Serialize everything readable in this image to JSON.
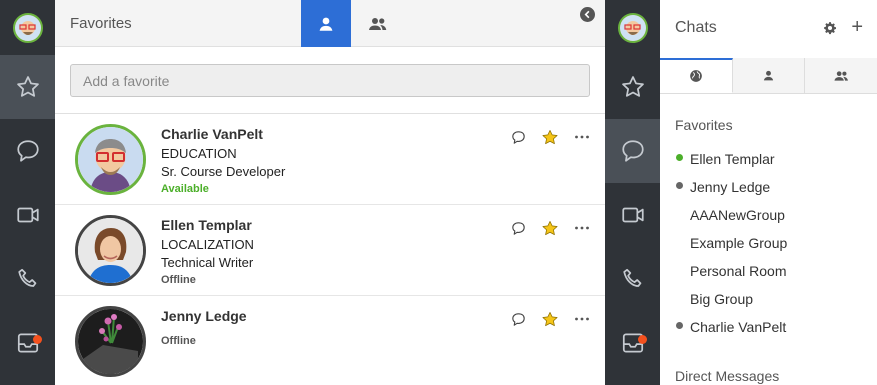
{
  "colors": {
    "rail": "#2f3338",
    "rail_active": "#4a5057",
    "accent": "#2d6ed6",
    "online": "#4caf2a",
    "offline": "#666666",
    "star": "#f5c518",
    "notify": "#f4511e"
  },
  "favorites_panel": {
    "title": "Favorites",
    "search_placeholder": "Add a favorite",
    "items": [
      {
        "name": "Charlie VanPelt",
        "line2": "EDUCATION",
        "line3": "Sr. Course Developer",
        "status": "Available"
      },
      {
        "name": "Ellen Templar",
        "line2": "LOCALIZATION",
        "line3": "Technical Writer",
        "status": "Offline"
      },
      {
        "name": "Jenny Ledge",
        "line2": "",
        "line3": "",
        "status": "Offline"
      }
    ]
  },
  "chats_panel": {
    "title": "Chats",
    "favorites_header": "Favorites",
    "favorites": [
      {
        "name": "Ellen Templar",
        "presence": "online"
      },
      {
        "name": "Jenny Ledge",
        "presence": "offline"
      },
      {
        "name": "AAANewGroup",
        "presence": ""
      },
      {
        "name": "Example Group",
        "presence": ""
      },
      {
        "name": "Personal Room",
        "presence": ""
      },
      {
        "name": "Big Group",
        "presence": ""
      },
      {
        "name": "Charlie VanPelt",
        "presence": "offline"
      }
    ],
    "direct_header": "Direct Messages"
  }
}
